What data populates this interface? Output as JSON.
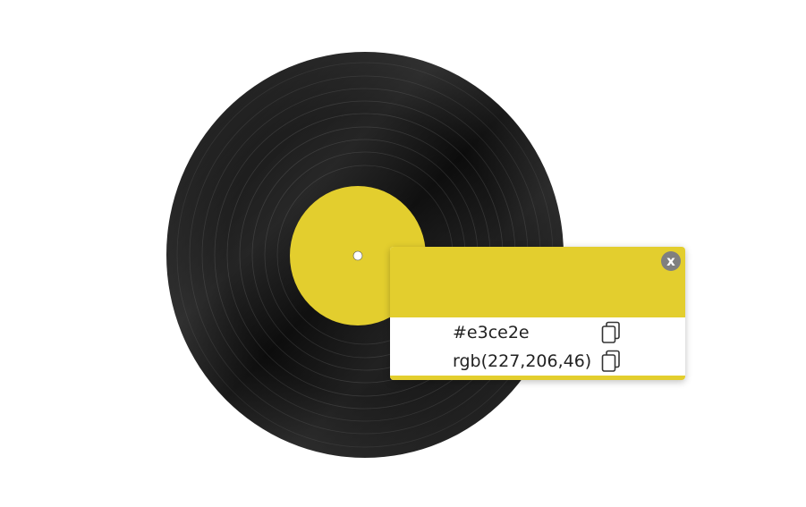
{
  "colors": {
    "sampled": "#e3ce2e",
    "close_button_bg": "#7f7f7f",
    "record_black": "#0b0b0b",
    "label_yellow": "#e3ce2e"
  },
  "record": {
    "icon": "vinyl-record-icon"
  },
  "popup": {
    "close_label": "x",
    "hex_value": "#e3ce2e",
    "rgb_value": "rgb(227,206,46)",
    "copy_icon": "copy-icon"
  }
}
